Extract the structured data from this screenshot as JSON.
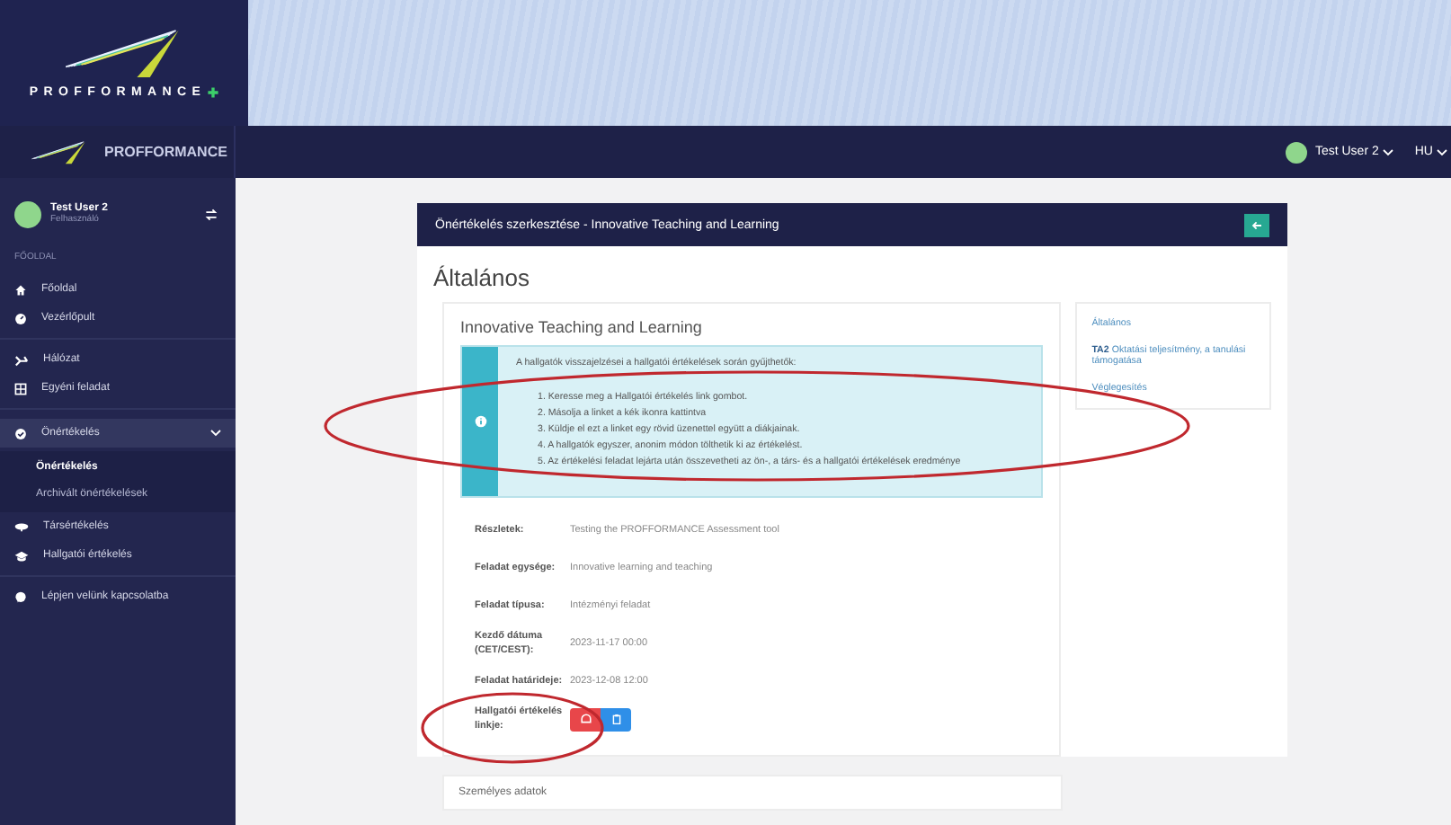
{
  "banner": {
    "brand": "PROFFORMANCE"
  },
  "header": {
    "brand": "PROFFORMANCE",
    "user": "Test User 2",
    "language": "HU"
  },
  "sidebar": {
    "user": {
      "name": "Test User 2",
      "role": "Felhasználó"
    },
    "section": "FŐOLDAL",
    "groups": [
      [
        {
          "label": "Főoldal",
          "expanded": false
        },
        {
          "label": "Vezérlőpult",
          "expanded": false
        }
      ],
      [
        {
          "label": "Hálózat",
          "expanded": false
        },
        {
          "label": "Egyéni feladat",
          "expanded": false
        }
      ],
      [
        {
          "label": "Önértékelés",
          "expanded": true,
          "children": [
            {
              "label": "Önértékelés",
              "selected": true
            },
            {
              "label": "Archivált önértékelések",
              "selected": false
            }
          ]
        },
        {
          "label": "Társértékelés",
          "expanded": false
        },
        {
          "label": "Hallgatói értékelés",
          "expanded": false
        }
      ],
      [
        {
          "label": "Lépjen velünk kapcsolatba",
          "expanded": false
        }
      ]
    ]
  },
  "card": {
    "title": "Önértékelés szerkesztése - Innovative Teaching and Learning",
    "heading": "Általános",
    "details": {
      "title": "Innovative Teaching and Learning",
      "info": {
        "intro": "A hallgatók visszajelzései a hallgatói értékelések során gyűjthetők:",
        "steps": [
          "1. Keresse meg a Hallgatói értékelés link gombot.",
          "2. Másolja a linket a kék ikonra kattintva",
          "3. Küldje el ezt a linket egy rövid üzenettel együtt a diákjainak.",
          "4. A hallgatók egyszer, anonim módon tölthetik ki az értékelést.",
          "5. Az értékelési feladat lejárta után összevetheti az ön-, a társ- és a hallgatói értékelések eredménye"
        ]
      },
      "rows": [
        {
          "label": "Részletek:",
          "value": "Testing the PROFFORMANCE Assessment tool"
        },
        {
          "label": "Feladat egysége:",
          "value": "Innovative learning and teaching"
        },
        {
          "label": "Feladat típusa:",
          "value": "Intézményi feladat"
        },
        {
          "label": "Kezdő dátuma (CET/CEST):",
          "value": "2023-11-17 00:00"
        },
        {
          "label": "Feladat határideje:",
          "value": "2023-12-08 12:00"
        }
      ],
      "link_label": "Hallgatói értékelés linkje:"
    },
    "nav": [
      {
        "text": "Általános"
      },
      {
        "prefix": "TA2",
        "text": "Oktatási teljesítmény, a tanulási támogatása"
      },
      {
        "text": "Véglegesítés"
      }
    ],
    "next_section": "Személyes adatok"
  }
}
